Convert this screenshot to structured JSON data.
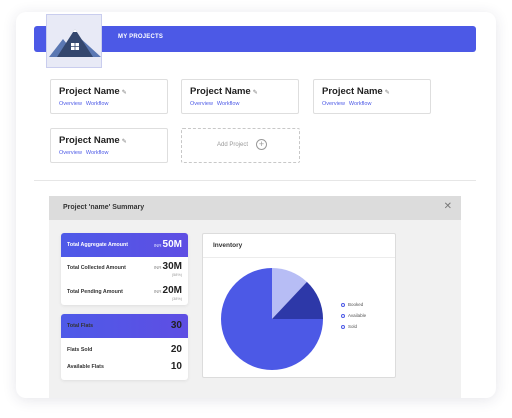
{
  "header": {
    "title": "MY PROJECTS",
    "brand_color": "#4c59e6"
  },
  "projects": [
    {
      "name": "Project Name",
      "edit_icon": "edit-icon",
      "links": [
        "Overview",
        "Workflow"
      ]
    },
    {
      "name": "Project Name",
      "edit_icon": "edit-icon",
      "links": [
        "Overview",
        "Workflow"
      ]
    },
    {
      "name": "Project Name",
      "edit_icon": "edit-icon",
      "links": [
        "Overview",
        "Workflow"
      ]
    },
    {
      "name": "Project Name",
      "edit_icon": "edit-icon",
      "links": [
        "Overview",
        "Workflow"
      ]
    }
  ],
  "add_project": {
    "label": "Add Project",
    "icon": "plus-circle-icon"
  },
  "summary": {
    "title": "Project 'name' Summary",
    "close_icon": "close-icon",
    "amounts": [
      {
        "label": "Total Aggregate Amount",
        "unit": "INR",
        "value": "50M",
        "pct": ""
      },
      {
        "label": "Total Collected Amount",
        "unit": "INR",
        "value": "30M",
        "pct": "(58%)"
      },
      {
        "label": "Total Pending Amount",
        "unit": "INR",
        "value": "20M",
        "pct": "(38%)"
      }
    ],
    "flats": [
      {
        "label": "Total Flats",
        "value": "30"
      },
      {
        "label": "Flats Sold",
        "value": "20"
      },
      {
        "label": "Available Flats",
        "value": "10"
      }
    ]
  },
  "inventory": {
    "title": "Inventory",
    "legend": [
      {
        "label": "Booked",
        "color": "#b7bdf5"
      },
      {
        "label": "Available",
        "color": "#2d38a8"
      },
      {
        "label": "Sold",
        "color": "#4c59e6"
      }
    ]
  },
  "chart_data": {
    "type": "pie",
    "title": "Inventory",
    "categories": [
      "Booked",
      "Available",
      "Sold"
    ],
    "values": [
      12,
      13,
      75
    ],
    "colors": [
      "#b7bdf5",
      "#2d38a8",
      "#4c59e6"
    ],
    "legend_position": "right"
  }
}
